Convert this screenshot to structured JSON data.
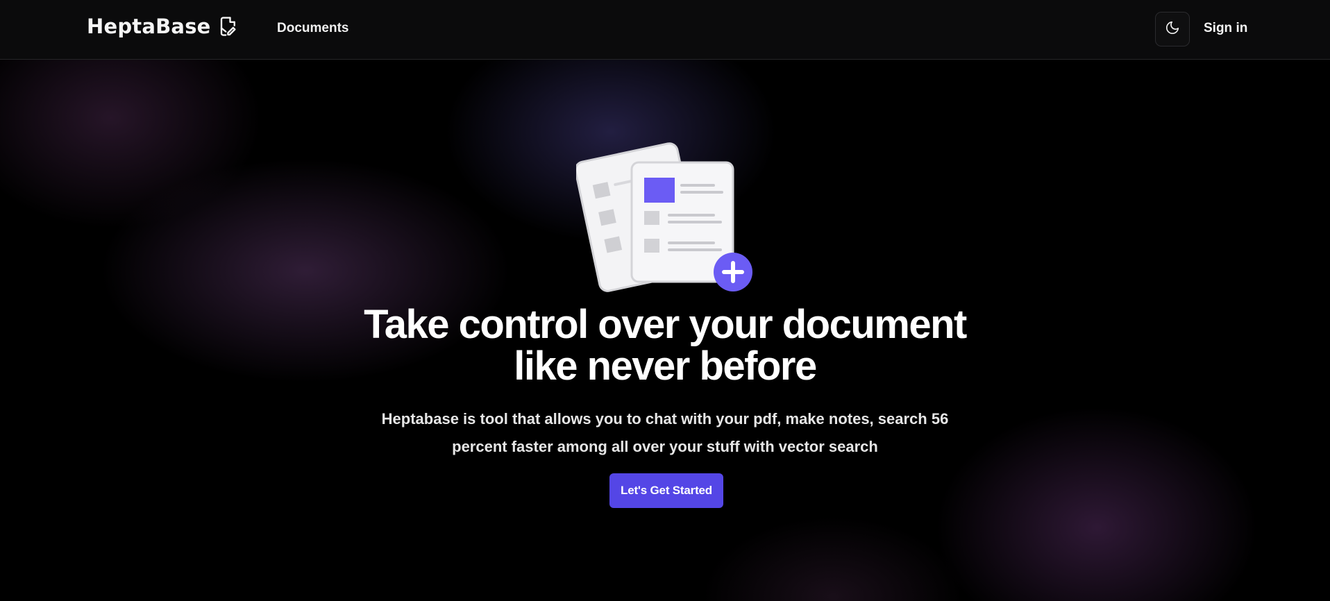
{
  "navbar": {
    "brand": "HeptaBase",
    "brand_icon": "document-edit-icon",
    "links": [
      {
        "label": "Documents"
      }
    ],
    "theme_toggle_icon": "moon-icon",
    "sign_in_label": "Sign in"
  },
  "hero": {
    "illustration_icon": "documents-add-icon",
    "headline_line1": "Take control over your document",
    "headline_line2": "like never before",
    "subtitle_line1": "Heptabase is tool that allows you to chat with your pdf, make notes, search 56",
    "subtitle_line2": "percent faster among all over your stuff with vector search",
    "cta_label": "Let's Get Started"
  },
  "colors": {
    "accent": "#5446e6",
    "navbar_bg": "#0b0b0c",
    "page_bg": "#000000"
  }
}
